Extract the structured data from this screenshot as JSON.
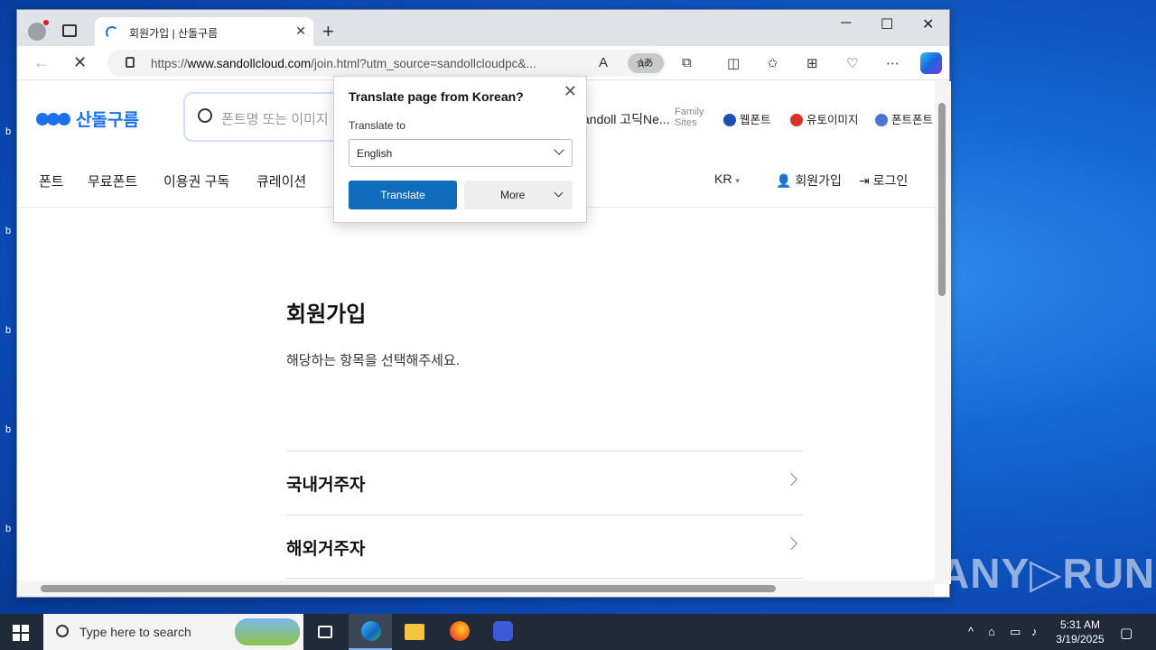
{
  "browser": {
    "tab_title": "회원가입 | 산돌구름",
    "new_tab_label": "+",
    "window_controls": {
      "minimize": "─",
      "maximize": "☐",
      "close": "✕"
    },
    "url_prefix": "https://",
    "url_domain": "www.sandollcloud.com",
    "url_path": "/join.html?utm_source=sandollcloudpc&...",
    "translate_icon_label": "aあ"
  },
  "site": {
    "logo_text": "산돌구름",
    "search_placeholder": "폰트명 또는 이미지",
    "header_family": {
      "current_text": "andoll 고딕Ne...",
      "family_label_1": "Family",
      "family_label_2": "Sites",
      "links": [
        {
          "label": "웹폰트",
          "color": "#1d4fb8"
        },
        {
          "label": "유토이미지",
          "color": "#d93025"
        },
        {
          "label": "폰트폰트",
          "color": "#4a72d8"
        }
      ]
    },
    "menu": [
      "폰트",
      "무료폰트",
      "이용권 구독",
      "큐레이션"
    ],
    "lang": "KR",
    "signup_link": "회원가입",
    "login_link": "로그인"
  },
  "main": {
    "title": "회원가입",
    "subtitle": "해당하는 항목을 선택해주세요.",
    "options": [
      "국내거주자",
      "해외거주자"
    ]
  },
  "translate_popup": {
    "title": "Translate page from Korean?",
    "translate_to_label": "Translate to",
    "selected_language": "English",
    "translate_button": "Translate",
    "more_button": "More"
  },
  "taskbar": {
    "search_placeholder": "Type here to search",
    "time": "5:31 AM",
    "date": "3/19/2025"
  },
  "watermark": "ANY▷RUN"
}
